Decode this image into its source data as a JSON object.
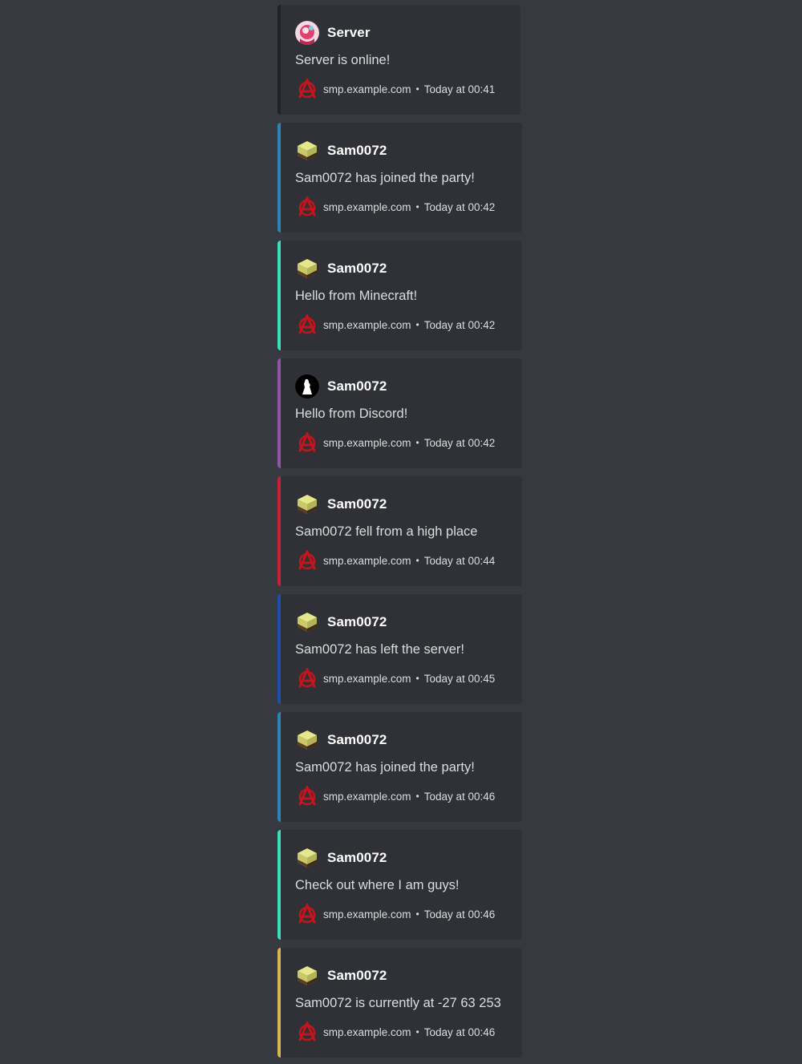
{
  "footer_icon": "anarchy-icon",
  "footer_separator": "•",
  "messages": [
    {
      "author": "Server",
      "avatar": "server-avatar",
      "text": "Server is online!",
      "host": "smp.example.com",
      "time": "Today at 00:41",
      "accent": "#202225"
    },
    {
      "author": "Sam0072",
      "avatar": "minecraft-block-icon",
      "text": "Sam0072 has joined the party!",
      "host": "smp.example.com",
      "time": "Today at 00:42",
      "accent": "#2b86b5"
    },
    {
      "author": "Sam0072",
      "avatar": "minecraft-block-icon",
      "text": "Hello from Minecraft!",
      "host": "smp.example.com",
      "time": "Today at 00:42",
      "accent": "#3be0bd"
    },
    {
      "author": "Sam0072",
      "avatar": "discord-avatar",
      "text": "Hello from Discord!",
      "host": "smp.example.com",
      "time": "Today at 00:42",
      "accent": "#8f55a6"
    },
    {
      "author": "Sam0072",
      "avatar": "minecraft-block-icon",
      "text": "Sam0072 fell from a high place",
      "host": "smp.example.com",
      "time": "Today at 00:44",
      "accent": "#cc1f37"
    },
    {
      "author": "Sam0072",
      "avatar": "minecraft-block-icon",
      "text": "Sam0072 has left the server!",
      "host": "smp.example.com",
      "time": "Today at 00:45",
      "accent": "#1f4fae"
    },
    {
      "author": "Sam0072",
      "avatar": "minecraft-block-icon",
      "text": "Sam0072 has joined the party!",
      "host": "smp.example.com",
      "time": "Today at 00:46",
      "accent": "#2b86b5"
    },
    {
      "author": "Sam0072",
      "avatar": "minecraft-block-icon",
      "text": "Check out where I am guys!",
      "host": "smp.example.com",
      "time": "Today at 00:46",
      "accent": "#3be0bd"
    },
    {
      "author": "Sam0072",
      "avatar": "minecraft-block-icon",
      "text": "Sam0072 is currently at -27 63 253",
      "host": "smp.example.com",
      "time": "Today at 00:46",
      "accent": "#d6b657"
    }
  ]
}
